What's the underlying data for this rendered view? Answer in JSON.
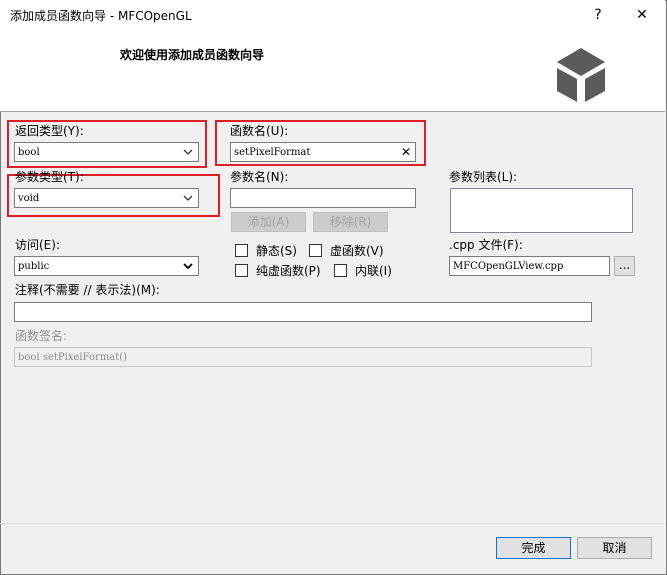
{
  "window": {
    "title": "添加成员函数向导 - MFCOpenGL",
    "help_glyph": "?",
    "close_glyph": "✕"
  },
  "header": {
    "title": "欢迎使用添加成员函数向导",
    "logo_icon": "cube-icon"
  },
  "form": {
    "return_type": {
      "label": "返回类型(Y):",
      "value": "bool"
    },
    "function_name": {
      "label": "函数名(U):",
      "value": "setPixelFormat",
      "clear_glyph": "✕"
    },
    "param_type": {
      "label": "参数类型(T):",
      "value": "void"
    },
    "param_name": {
      "label": "参数名(N):",
      "value": ""
    },
    "add_button": "添加(A)",
    "remove_button": "移除(R)",
    "param_list": {
      "label": "参数列表(L):"
    },
    "access": {
      "label": "访问(E):",
      "value": "public"
    },
    "static_check": {
      "label": "静态(S)",
      "checked": false
    },
    "virtual_check": {
      "label": "虚函数(V)",
      "checked": false
    },
    "pure_virtual_check": {
      "label": "纯虚函数(P)",
      "checked": false
    },
    "inline_check": {
      "label": "内联(I)",
      "checked": false
    },
    "cpp_file": {
      "label": ".cpp 文件(F):",
      "value": "MFCOpenGLView.cpp",
      "browse": "..."
    },
    "comment": {
      "label": "注释(不需要 // 表示法)(M):",
      "value": ""
    },
    "signature": {
      "label": "函数签名:",
      "value": "bool setPixelFormat()"
    }
  },
  "footer": {
    "finish_button": "完成",
    "cancel_button": "取消"
  },
  "colors": {
    "highlight": "#e01e25",
    "accent": "#0078d7",
    "logo": "#5b5b5b"
  }
}
